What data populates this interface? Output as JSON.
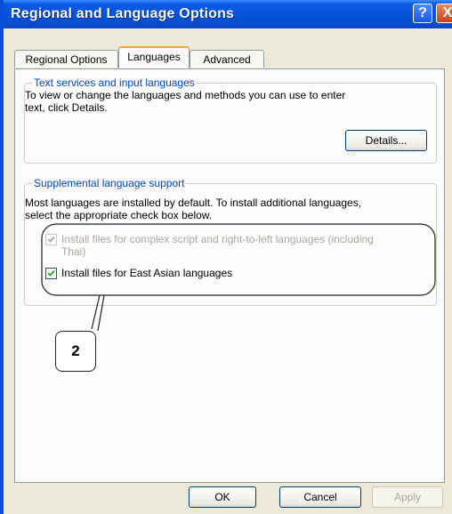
{
  "window": {
    "title": "Regional and Language Options",
    "help_label": "?",
    "close_label": "X"
  },
  "tabs": [
    {
      "label": "Regional Options",
      "active": false
    },
    {
      "label": "Languages",
      "active": true
    },
    {
      "label": "Advanced",
      "active": false
    }
  ],
  "text_services": {
    "legend": "Text services and input languages",
    "description_line1": "To view or change the languages and methods you can use to enter",
    "description_line2": "text, click Details.",
    "details_button": "Details..."
  },
  "supplemental": {
    "legend": "Supplemental language support",
    "description_line1": "Most languages are installed by default. To install additional languages,",
    "description_line2": "select the appropriate check box below.",
    "complex_script_line1": "Install files for complex script and right-to-left languages (including",
    "complex_script_line2": "Thai)",
    "complex_script_checked": true,
    "complex_script_enabled": false,
    "east_asian_label": "Install files for East Asian languages",
    "east_asian_checked": true
  },
  "callout": {
    "label": "2"
  },
  "buttons": {
    "ok": "OK",
    "cancel": "Cancel",
    "apply": "Apply"
  },
  "colors": {
    "title_bar": "#0453D9",
    "legend_text": "#0046D5",
    "active_tab_highlight": "#F1A843",
    "dialog_face": "#ECE9D8"
  }
}
